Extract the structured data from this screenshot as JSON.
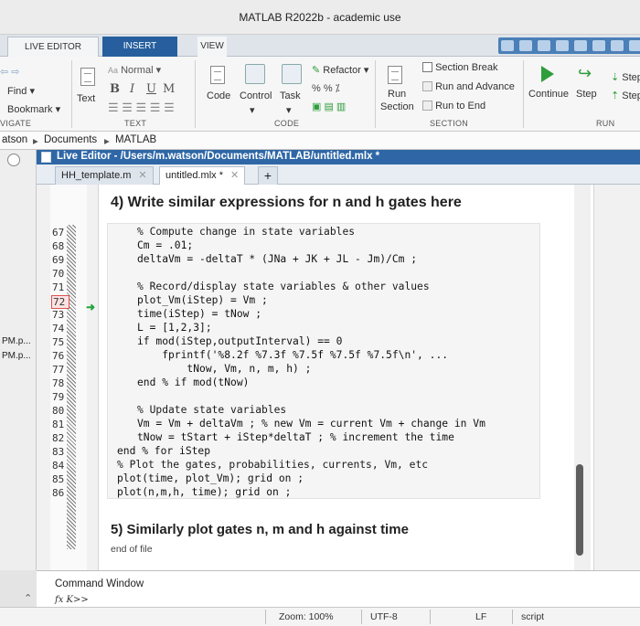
{
  "window": {
    "title": "MATLAB R2022b - academic use"
  },
  "tabs": {
    "live_editor": "LIVE EDITOR",
    "insert": "INSERT",
    "view": "VIEW"
  },
  "ribbon": {
    "find": "Find",
    "bookmark": "Bookmark",
    "navigate_label": "VIGATE",
    "text_btn": "Text",
    "normal_style": "Normal",
    "format_b": "B",
    "format_i": "I",
    "format_u": "U",
    "format_m": "M",
    "text_label": "TEXT",
    "refactor": "Refactor",
    "code_btn": "Code",
    "control_btn": "Control",
    "task_btn": "Task",
    "code_label": "CODE",
    "run_section": "Run Section",
    "run_section_line1": "Run",
    "run_section_line2": "Section",
    "section_break": "Section Break",
    "run_and_advance": "Run and Advance",
    "run_to_end": "Run to End",
    "section_label": "SECTION",
    "continue_btn": "Continue",
    "step_btn": "Step",
    "step_in": "Step",
    "step_out": "Step",
    "run_label": "RUN"
  },
  "breadcrumb": [
    "atson",
    "Documents",
    "MATLAB"
  ],
  "editor": {
    "title": "Live Editor - /Users/m.watson/Documents/MATLAB/untitled.mlx *",
    "tabs": [
      {
        "label": "HH_template.m"
      },
      {
        "label": "untitled.mlx *"
      }
    ],
    "add_tab": "+",
    "heading4": "4) Write similar expressions for n and h gates here",
    "heading5": "5) Similarly plot gates n, m and h against time",
    "end_of_file": "end of file",
    "current_line": "72",
    "lines": [
      {
        "n": "67",
        "code": "% Compute change in state variables"
      },
      {
        "n": "68",
        "code": "Cm = .01;"
      },
      {
        "n": "69",
        "code": "deltaVm = -deltaT * (JNa + JK + JL - Jm)/Cm ;"
      },
      {
        "n": "70",
        "code": ""
      },
      {
        "n": "71",
        "code": "% Record/display state variables & other values"
      },
      {
        "n": "72",
        "code": "plot_Vm(iStep) = Vm ;"
      },
      {
        "n": "73",
        "code": "time(iStep) = tNow ;"
      },
      {
        "n": "74",
        "code": "L = [1,2,3];"
      },
      {
        "n": "75",
        "code": "if mod(iStep,outputInterval) == 0"
      },
      {
        "n": "76",
        "code": "    fprintf('%8.2f %7.3f %7.5f %7.5f %7.5f\\n', ..."
      },
      {
        "n": "77",
        "code": "        tNow, Vm, n, m, h) ;"
      },
      {
        "n": "78",
        "code": "end % if mod(tNow)"
      },
      {
        "n": "79",
        "code": ""
      },
      {
        "n": "80",
        "code": "% Update state variables"
      },
      {
        "n": "81",
        "code": "Vm = Vm + deltaVm ; % new Vm = current Vm + change in Vm"
      },
      {
        "n": "82",
        "code": "tNow = tStart + iStep*deltaT ; % increment the time"
      },
      {
        "n": "83",
        "code": "end % for iStep"
      },
      {
        "n": "84",
        "code": "% Plot the gates, probabilities, currents, Vm, etc"
      },
      {
        "n": "85",
        "code": "plot(time, plot_Vm); grid on ;"
      },
      {
        "n": "86",
        "code": "plot(n,m,h, time); grid on ;"
      }
    ]
  },
  "left_panel": {
    "item1": "PM.p...",
    "item2": "PM.p..."
  },
  "command_window": {
    "title": "Command Window",
    "prompt": "fx K>>"
  },
  "statusbar": {
    "zoom": "Zoom: 100%",
    "encoding": "UTF-8",
    "line_ending": "LF",
    "mode": "script"
  }
}
